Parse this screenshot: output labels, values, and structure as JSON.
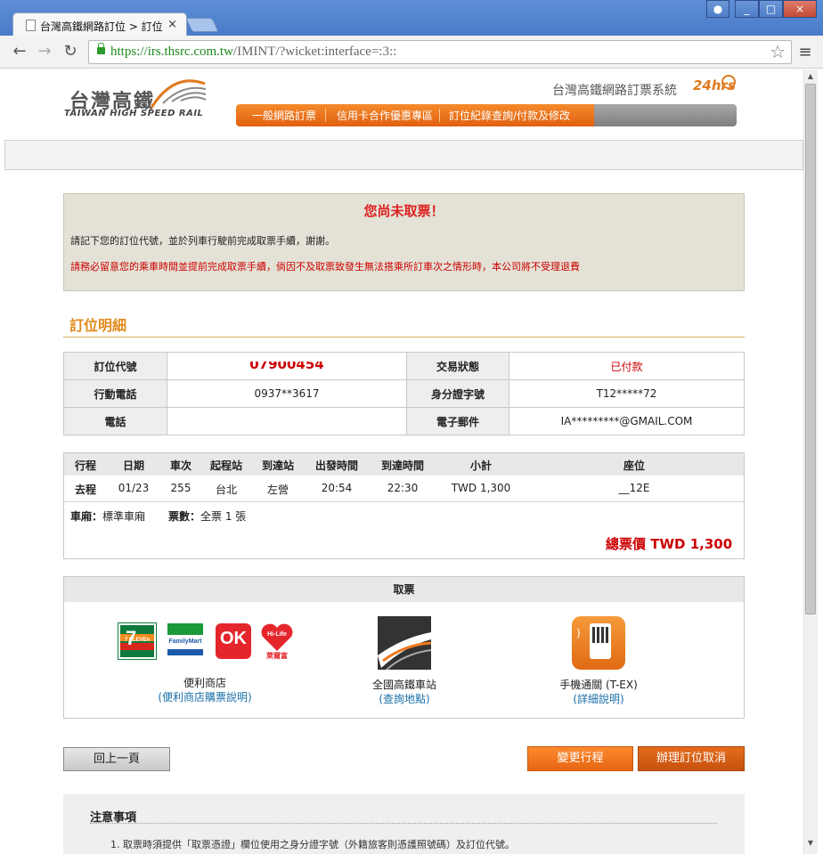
{
  "browser": {
    "tab_title": "台灣高鐵網路訂位 > 訂位",
    "tab_close": "×",
    "url_scheme": "https://",
    "url_host": "irs.thsrc.com.tw",
    "url_path": "/IMINT/?wicket:interface=:3::",
    "window_buttons": [
      "_",
      "□",
      "×"
    ]
  },
  "header": {
    "logo_cn": "台灣高鐵",
    "logo_en": "TAIWAN HIGH SPEED RAIL",
    "system_title": "台灣高鐵網路訂票系統",
    "hrs": "24hrs",
    "nav": [
      "一般網路訂票",
      "信用卡合作優惠專區",
      "訂位紀錄查詢/付款及修改"
    ]
  },
  "notice": {
    "title": "您尚未取票！",
    "line1": "請記下您的訂位代號，並於列車行駛前完成取票手續，謝謝。",
    "line2": "請務必留意您的乘車時間並提前完成取票手續，倘因不及取票致發生無法搭乘所訂車次之情形時，本公司將不受理退費"
  },
  "section_title": "訂位明細",
  "booking": {
    "code_label": "訂位代號",
    "code_value": "07900454",
    "status_label": "交易狀態",
    "status_value": "已付款",
    "mobile_label": "行動電話",
    "mobile_value": "0937**3617",
    "id_label": "身分證字號",
    "id_value": "T12*****72",
    "phone_label": "電話",
    "phone_value": "",
    "email_label": "電子郵件",
    "email_value": "IA*********@GMAIL.COM"
  },
  "trip": {
    "headers": [
      "行程",
      "日期",
      "車次",
      "起程站",
      "到達站",
      "出發時間",
      "到達時間",
      "小計",
      "座位"
    ],
    "row": [
      "去程",
      "01/23",
      "255",
      "台北",
      "左營",
      "20:54",
      "22:30",
      "TWD 1,300",
      "__12E"
    ],
    "car_label": "車廂：",
    "car_value": "標準車廂",
    "ticket_label": "票數：",
    "ticket_value": "全票 1 張",
    "total_label": "總票價",
    "total_value": "TWD 1,300"
  },
  "pickup": {
    "title": "取票",
    "store_label": "便利商店",
    "store_link": "(便利商店購票說明)",
    "station_label": "全國高鐵車站",
    "station_link": "(查詢地點)",
    "mobile_label": "手機通關 (T-EX)",
    "mobile_link": "(詳細說明)",
    "brands": {
      "seven": "7 ELEVEn",
      "familymart": "FamilyMart",
      "ok": "OK",
      "hilife": "Hi-Life",
      "hilife_cn": "萊爾富"
    }
  },
  "buttons": {
    "back": "回上一頁",
    "change": "變更行程",
    "cancel": "辦理訂位取消"
  },
  "notes": {
    "title": "注意事項",
    "item1": "1. 取票時須提供「取票憑證」欄位使用之身分證字號（外籍旅客則憑護照號碼）及訂位代號。"
  },
  "colors": {
    "accent_orange": "#f07a20",
    "alert_red": "#cc0000",
    "link_blue": "#1a6fa8"
  }
}
